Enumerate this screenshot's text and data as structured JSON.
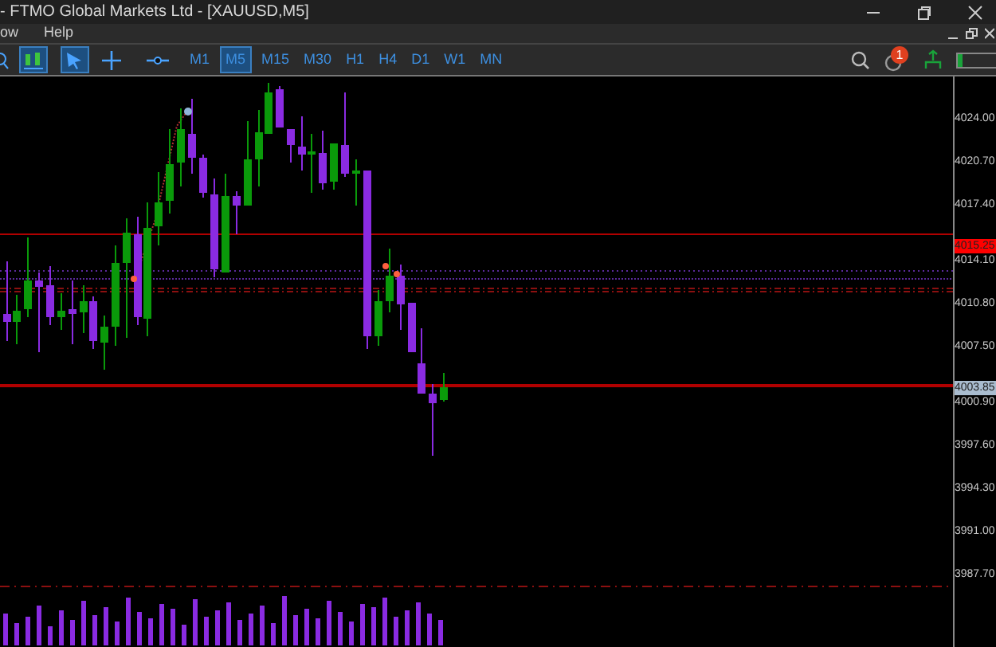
{
  "window": {
    "title": "- FTMO Global Markets Ltd - [XAUUSD,M5]"
  },
  "menu": [
    "ow",
    "Help"
  ],
  "tools": [
    {
      "kind": "chart",
      "selected": true
    },
    {
      "kind": "cursor",
      "selected": true
    },
    {
      "kind": "crosshair",
      "selected": false
    },
    {
      "kind": "line",
      "selected": false
    }
  ],
  "timeframes": [
    {
      "label": "M1",
      "selected": false
    },
    {
      "label": "M5",
      "selected": true
    },
    {
      "label": "M15",
      "selected": false
    },
    {
      "label": "M30",
      "selected": false
    },
    {
      "label": "H1",
      "selected": false
    },
    {
      "label": "H4",
      "selected": false
    },
    {
      "label": "D1",
      "selected": false
    },
    {
      "label": "W1",
      "selected": false
    },
    {
      "label": "MN",
      "selected": false
    }
  ],
  "notifications": {
    "badge": "1"
  },
  "price_axis": [
    {
      "kind": "tick",
      "label": "4024.00"
    },
    {
      "kind": "tick",
      "label": "4020.70"
    },
    {
      "kind": "tick",
      "label": "4017.40"
    },
    {
      "kind": "badge",
      "label": "4015.25",
      "color": "#ff0000"
    },
    {
      "kind": "tick",
      "label": "4014.10"
    },
    {
      "kind": "tick",
      "label": "4010.80"
    },
    {
      "kind": "tick",
      "label": "4007.50"
    },
    {
      "kind": "badge",
      "label": "4003.85",
      "color": "#a9bccf"
    },
    {
      "kind": "tick",
      "label": "4000.90"
    },
    {
      "kind": "tick",
      "label": "3997.60"
    },
    {
      "kind": "tick",
      "label": "3994.30"
    },
    {
      "kind": "tick",
      "label": "3991.00"
    },
    {
      "kind": "tick",
      "label": "3987.70"
    }
  ]
}
